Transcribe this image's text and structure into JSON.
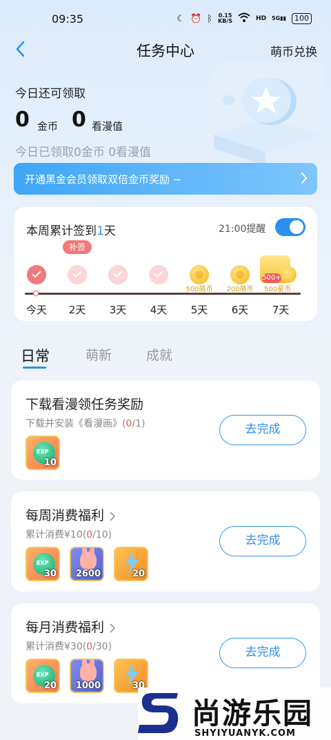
{
  "status_bar": {
    "time": "09:35",
    "network_speed": "0.15",
    "network_unit": "KB/S",
    "signal_tag": "5G",
    "battery": "100"
  },
  "header": {
    "title": "任务中心",
    "exchange_label": "萌币兑换"
  },
  "summary": {
    "available_label": "今日还可领取",
    "coins_value": "0",
    "coins_unit": "金币",
    "manga_value": "0",
    "manga_unit": "看漫值",
    "received_text": "今日已领取0金币 0看漫值"
  },
  "promo": {
    "text": "开通黑金会员领取双倍金币奖励 ~"
  },
  "signin": {
    "title_prefix": "本周累计签到",
    "count": "1",
    "title_suffix": "天",
    "remind_label": "21:00提醒",
    "remind_on": true,
    "makeup_label": "补签",
    "days": [
      {
        "label": "今天",
        "state": "checked",
        "reward": ""
      },
      {
        "label": "2天",
        "state": "checked-faint",
        "reward": ""
      },
      {
        "label": "3天",
        "state": "checked-faint",
        "reward": ""
      },
      {
        "label": "4天",
        "state": "checked-faint",
        "reward": ""
      },
      {
        "label": "5天",
        "state": "coin",
        "reward": "500萌币"
      },
      {
        "label": "6天",
        "state": "coin",
        "reward": "200萌币"
      },
      {
        "label": "7天",
        "state": "box",
        "reward": "500星币"
      }
    ],
    "big_box_badge": "500+"
  },
  "tabs": {
    "daily": "日常",
    "cute": "萌新",
    "achievement": "成就"
  },
  "tasks": [
    {
      "title": "下载看漫领任务奖励",
      "has_chevron": false,
      "desc_prefix": "下载并安装《看漫画》(",
      "progress": "0",
      "desc_suffix": "/1)",
      "button": "去完成",
      "rewards": [
        {
          "type": "exp",
          "amount": "10"
        }
      ]
    },
    {
      "title": "每周消费福利",
      "has_chevron": true,
      "desc_prefix": "累计消费¥10(",
      "progress": "0",
      "desc_suffix": "/10)",
      "button": "去完成",
      "rewards": [
        {
          "type": "exp",
          "amount": "30"
        },
        {
          "type": "bun",
          "amount": "2600"
        },
        {
          "type": "bolt",
          "amount": "20"
        }
      ]
    },
    {
      "title": "每月消费福利",
      "has_chevron": true,
      "desc_prefix": "累计消费¥30(",
      "progress": "0",
      "desc_suffix": "/30)",
      "button": "去完成",
      "rewards": [
        {
          "type": "exp",
          "amount": "20"
        },
        {
          "type": "bun",
          "amount": "1000"
        },
        {
          "type": "bolt",
          "amount": "30"
        }
      ]
    }
  ],
  "watermark": {
    "cn": "尚游乐园",
    "en": "SHYIYUANYK.COM"
  },
  "colors": {
    "accent": "#2b8ff0",
    "checked": "#f07979",
    "progress_red": "#ef5555"
  }
}
